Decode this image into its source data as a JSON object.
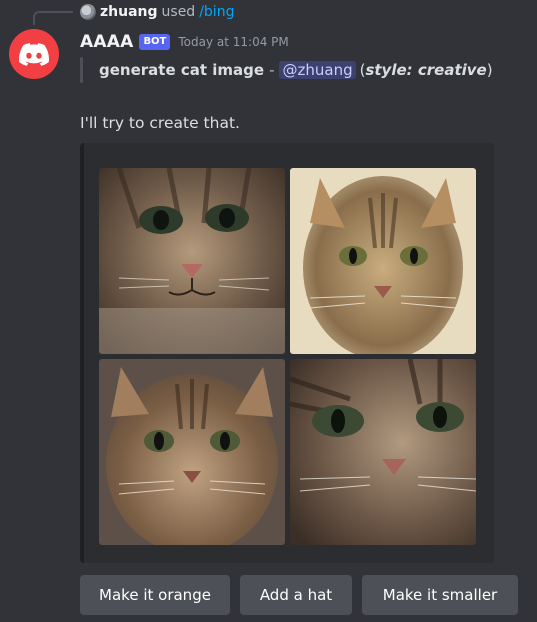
{
  "reply": {
    "user": "zhuang",
    "verb": "used",
    "command": "/bing"
  },
  "message": {
    "author": "AAAA",
    "tag": "BOT",
    "timestamp": "Today at 11:04 PM",
    "interaction": {
      "command_name": "generate cat image",
      "separator": "-",
      "mention": "@zhuang",
      "option_open": "(",
      "option_key": "style: creative",
      "option_close": ")"
    },
    "text": "I'll try to create that."
  },
  "images": [
    {
      "name": "cat-image-1",
      "alt": "Generated cat image 1"
    },
    {
      "name": "cat-image-2",
      "alt": "Generated cat image 2"
    },
    {
      "name": "cat-image-3",
      "alt": "Generated cat image 3"
    },
    {
      "name": "cat-image-4",
      "alt": "Generated cat image 4"
    }
  ],
  "buttons": {
    "orange": "Make it orange",
    "hat": "Add a hat",
    "smaller": "Make it smaller"
  },
  "colors": {
    "background": "#313338",
    "embed": "#2b2d31",
    "button": "#4e5058",
    "avatar": "#f23f43",
    "bot_tag": "#5865f2",
    "link": "#00a8fc"
  },
  "icons": {
    "avatar": "discord-logo-icon",
    "reply_avatar": "user-avatar-icon"
  }
}
